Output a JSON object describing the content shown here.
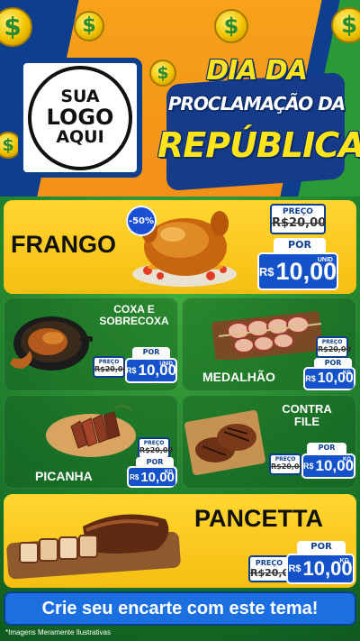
{
  "header": {
    "logo_line1": "SUA",
    "logo_line2": "LOGO",
    "logo_line3": "AQUI",
    "title_line1": "DIA DA",
    "title_line2": "PROCLAMAÇÃO DA",
    "title_line3": "REPÚBLICA",
    "coin_symbol": "$"
  },
  "colors": {
    "orange": "#f39017",
    "navy": "#0e3f8f",
    "yellow": "#ffd630",
    "green": "#1e7d2c",
    "price_blue": "#1452c9"
  },
  "products": {
    "frango": {
      "name": "FRANGO",
      "badge": "-50%",
      "preco_label": "PREÇO",
      "old_price": "R$20,00",
      "por_label": "POR",
      "currency": "R$",
      "price": "10,00",
      "unit": "UNID"
    },
    "coxa": {
      "name_line1": "COXA E",
      "name_line2": "SOBRECOXA",
      "preco_label": "PREÇO",
      "old_price": "R$20,00",
      "por_label": "POR",
      "currency": "R$",
      "price": "10,00",
      "unit": "UNID"
    },
    "medalhao": {
      "name": "MEDALHÃO",
      "preco_label": "PREÇO",
      "old_price": "R$20,00",
      "por_label": "POR",
      "currency": "R$",
      "price": "10,00",
      "unit": "KG"
    },
    "picanha": {
      "name": "PICANHA",
      "preco_label": "PREÇO",
      "old_price": "R$20,00",
      "por_label": "POR",
      "currency": "R$",
      "price": "10,00",
      "unit": "KG"
    },
    "contrafile": {
      "name_line1": "CONTRA",
      "name_line2": "FILE",
      "preco_label": "PREÇO",
      "old_price": "R$20,00",
      "por_label": "POR",
      "currency": "R$",
      "price": "10,00",
      "unit": "KG"
    },
    "pancetta": {
      "name": "PANCETTA",
      "preco_label": "PREÇO",
      "old_price": "R$20,00",
      "por_label": "POR",
      "currency": "R$",
      "price": "10,00",
      "unit": "KG"
    }
  },
  "cta": {
    "label": "Crie seu encarte com este tema!"
  },
  "disclaimer": "*Imagens Meramente Ilustrativas"
}
